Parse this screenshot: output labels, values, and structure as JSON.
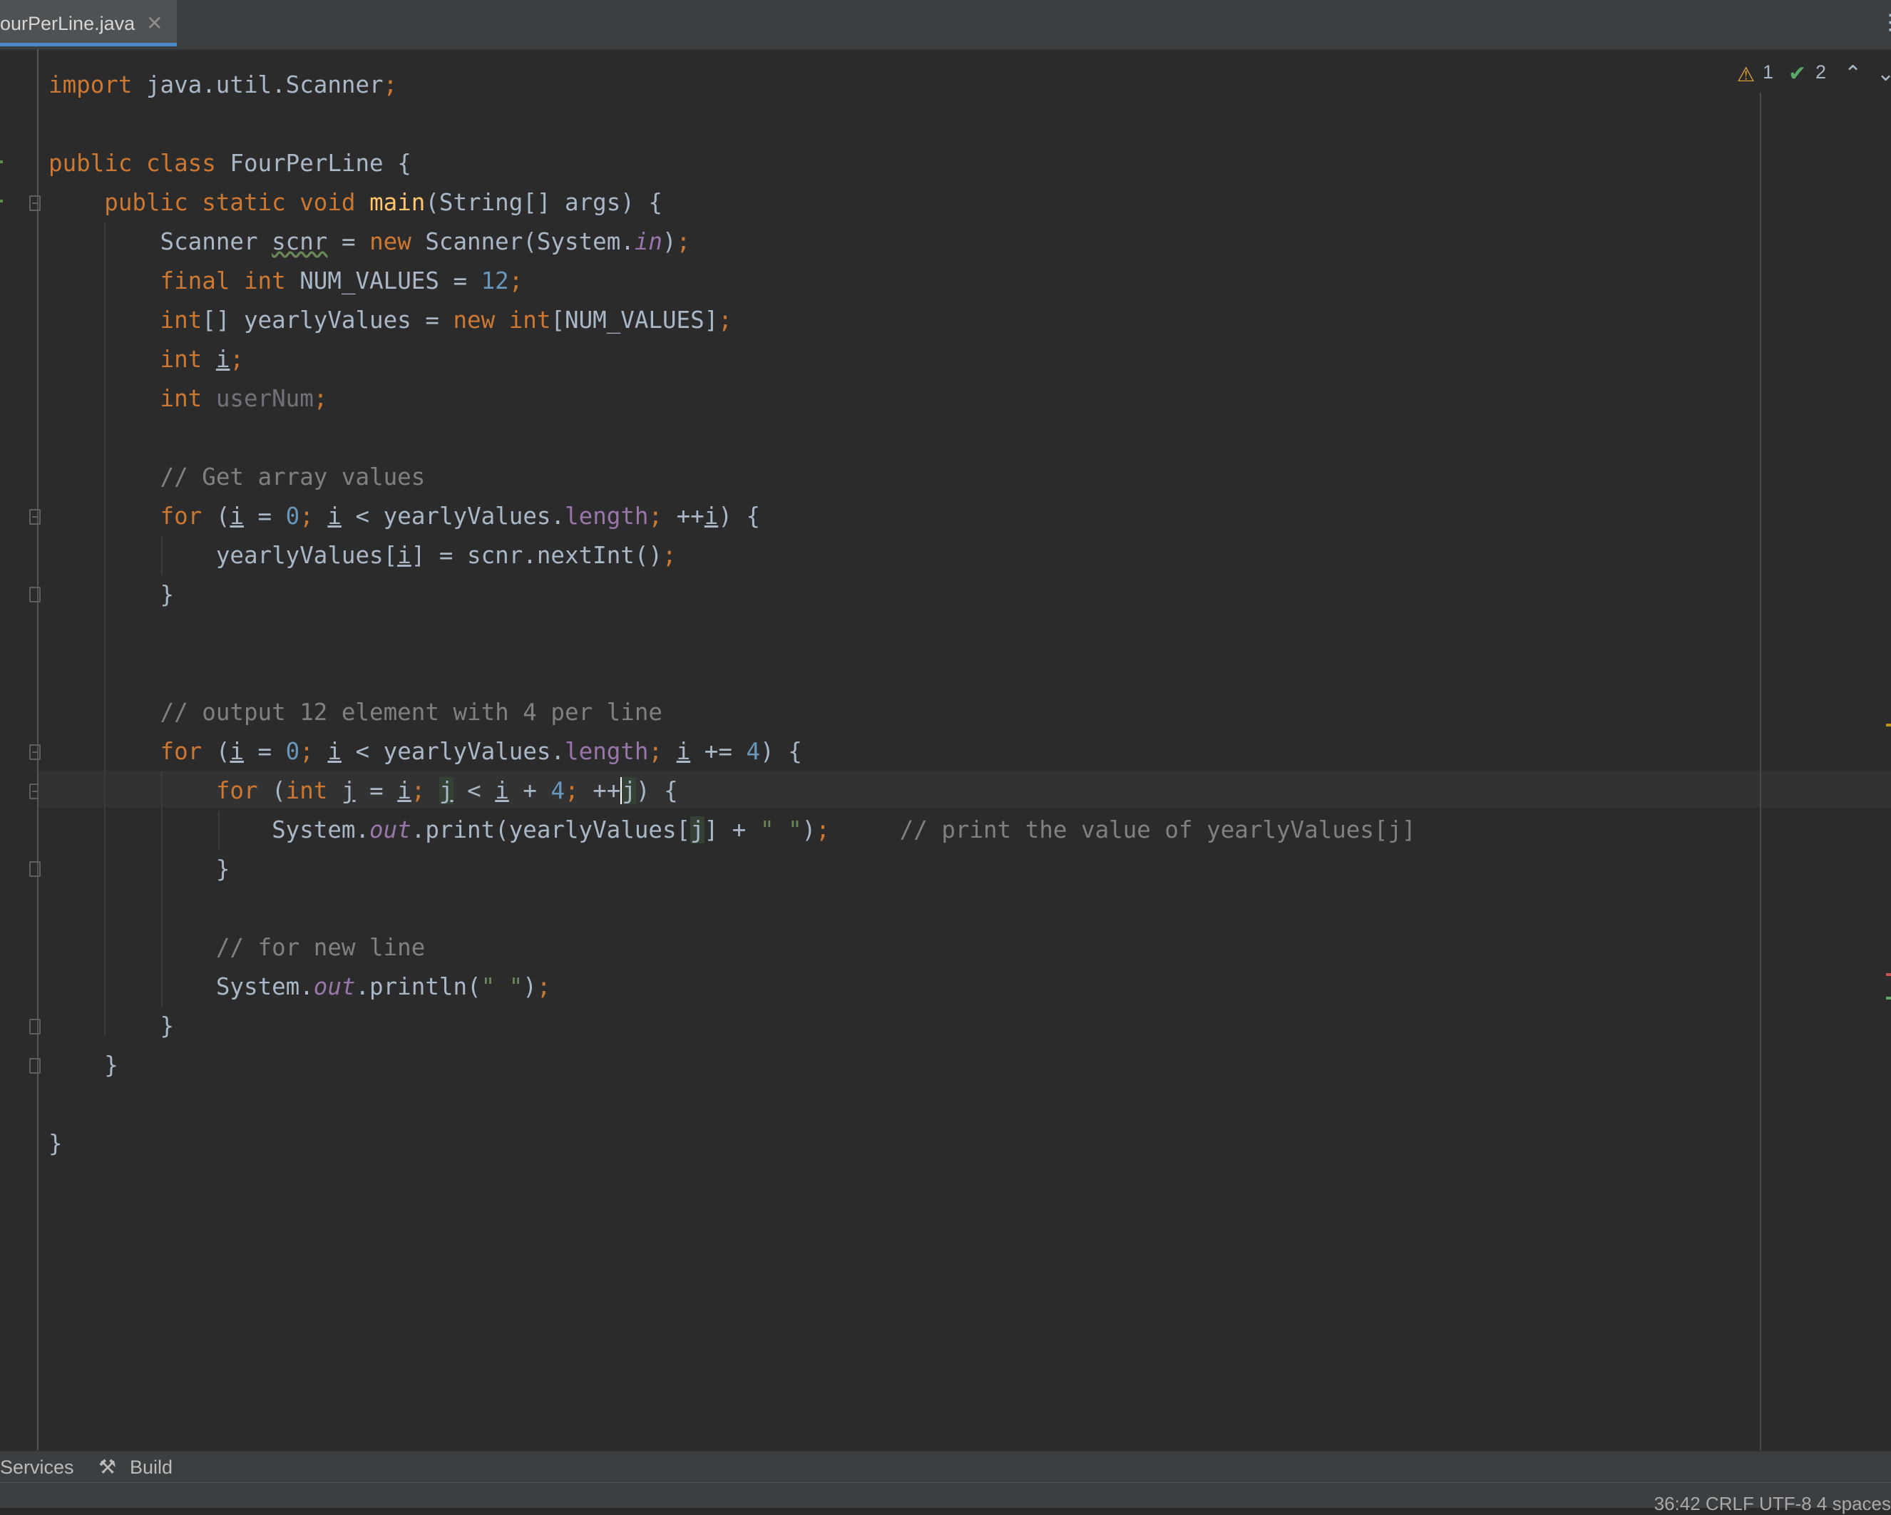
{
  "tab": {
    "label": "ourPerLine.java",
    "close": "✕"
  },
  "inspections": {
    "warnings": "1",
    "weak_warnings": "2"
  },
  "tool_windows": {
    "services": "Services",
    "build": "Build"
  },
  "status": {
    "text": "36:42   CRLF   UTF-8   4 spaces"
  },
  "code": {
    "l1_import": "import",
    "l1_rest": " java.util.Scanner",
    "l1_semi": ";",
    "l3_public": "public",
    "l3_class": "class",
    "l3_rest": " FourPerLine {",
    "l4_mods": "public static void",
    "l4_main": "main",
    "l4_rest": "(String[] args) {",
    "l5_a": "Scanner ",
    "l5_scnr": "scnr",
    "l5_b": " = ",
    "l5_new": "new",
    "l5_c": " Scanner(System.",
    "l5_in": "in",
    "l5_d": ")",
    "l5_semi": ";",
    "l6_final": "final",
    "l6_int": "int",
    "l6_b": " NUM_VALUES = ",
    "l6_num": "12",
    "l6_semi": ";",
    "l7_int": "int",
    "l7_b": "[] yearlyValues = ",
    "l7_new": "new",
    "l7_int2": "int",
    "l7_c": "[NUM_VALUES]",
    "l7_semi": ";",
    "l8_int": "int",
    "l8_i": "i",
    "l8_semi": ";",
    "l9_int": "int",
    "l9_var": "userNum",
    "l9_semi": ";",
    "l11_cmt": "// Get array values",
    "l12_for": "for",
    "l12_a": " (",
    "l12_i1": "i",
    "l12_b": " = ",
    "l12_zero": "0",
    "l12_s1": ";",
    "l12_i2": "i",
    "l12_c": " < yearlyValues.",
    "l12_len": "length",
    "l12_s2": ";",
    "l12_d": " ++",
    "l12_i3": "i",
    "l12_e": ") {",
    "l13_a": "yearlyValues[",
    "l13_i": "i",
    "l13_b": "] = scnr.nextInt()",
    "l13_semi": ";",
    "l14_brace": "}",
    "l17_cmt": "// output 12 element with 4 per line",
    "l18_for": "for",
    "l18_a": " (",
    "l18_i1": "i",
    "l18_b": " = ",
    "l18_zero": "0",
    "l18_s1": ";",
    "l18_i2": "i",
    "l18_c": " < yearlyValues.",
    "l18_len": "length",
    "l18_s2": ";",
    "l18_i3": "i",
    "l18_d": " += ",
    "l18_four": "4",
    "l18_e": ") {",
    "l19_for": "for",
    "l19_a": " (",
    "l19_int": "int",
    "l19_j1": "j",
    "l19_b": " = ",
    "l19_i1": "i",
    "l19_s1": ";",
    "l19_j2": "j",
    "l19_c": " < ",
    "l19_i2": "i",
    "l19_d": " + ",
    "l19_four": "4",
    "l19_s2": ";",
    "l19_e": " ++",
    "l19_j3": "j",
    "l19_f": ") {",
    "l20_a": "System.",
    "l20_out": "out",
    "l20_b": ".print(yearlyValues[",
    "l20_j": "j",
    "l20_c": "] + ",
    "l20_str": "\" \"",
    "l20_d": ")",
    "l20_semi": ";",
    "l20_cmt": "// print the value of yearlyValues[j]",
    "l21_brace": "}",
    "l23_cmt": "// for new line",
    "l24_a": "System.",
    "l24_out": "out",
    "l24_b": ".println(",
    "l24_str": "\" \"",
    "l24_c": ")",
    "l24_semi": ";",
    "l25_brace": "}",
    "l26_brace": "}",
    "l28_brace": "}"
  },
  "colors": {
    "background": "#2b2b2b",
    "keyword": "#cc7832",
    "number": "#6897bb",
    "string": "#6a8759",
    "comment": "#808080",
    "field": "#9876aa",
    "method": "#ffc66d",
    "text": "#a9b7c6"
  }
}
